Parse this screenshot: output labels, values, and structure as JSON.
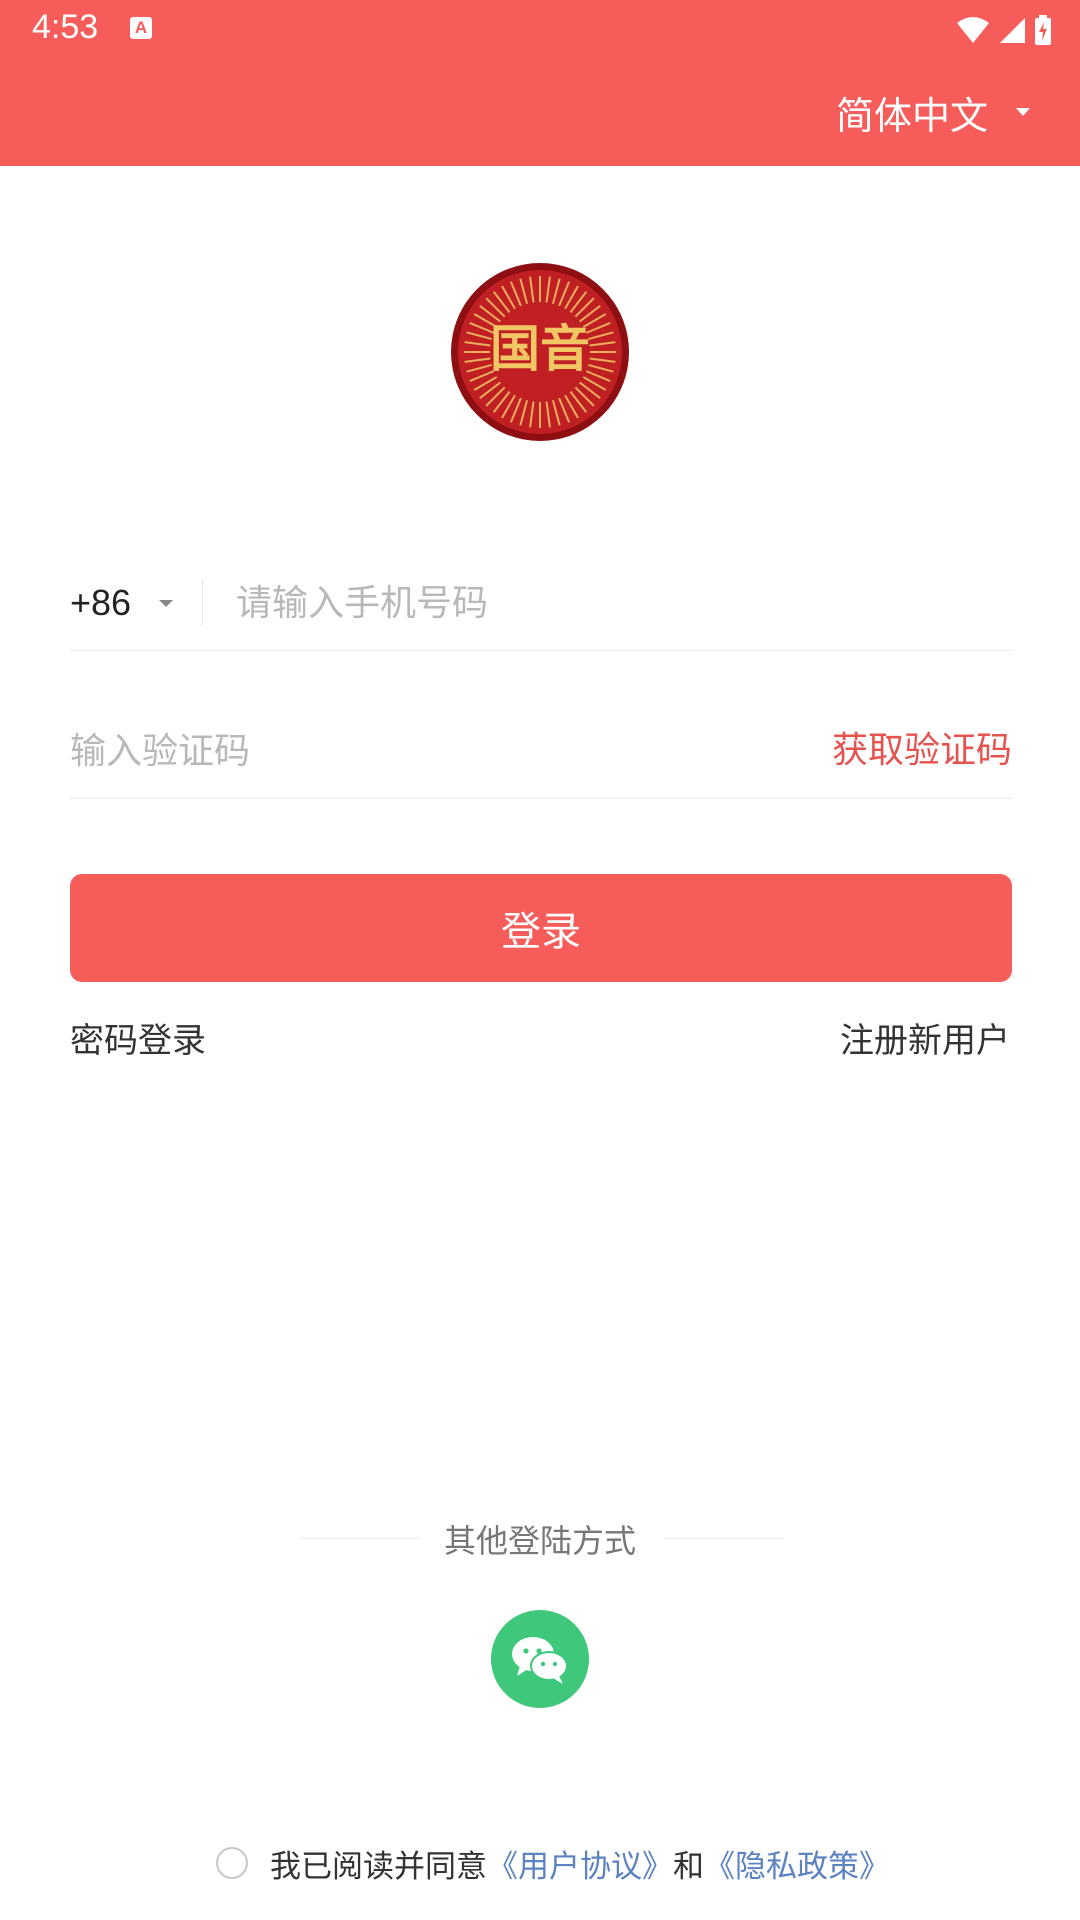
{
  "status_bar": {
    "time": "4:53",
    "notification_icon": "a-app-icon",
    "icons": [
      "wifi-icon",
      "signal-icon",
      "battery-charging-icon"
    ]
  },
  "header": {
    "language_label": "简体中文",
    "color": "#f65d5a"
  },
  "logo": {
    "text": "国音",
    "colors": {
      "ring": "#8e0f12",
      "face": "#c01f23",
      "gold": "#f1c766"
    }
  },
  "form": {
    "country_code": "+86",
    "phone_placeholder": "请输入手机号码",
    "code_placeholder": "输入验证码",
    "get_code_label": "获取验证码",
    "login_label": "登录",
    "password_login_label": "密码登录",
    "register_label": "注册新用户"
  },
  "other_login": {
    "title": "其他登陆方式",
    "methods": [
      "wechat-icon"
    ],
    "wechat_color": "#3fc77c"
  },
  "agreement": {
    "prefix": "我已阅读并同意",
    "user_agreement": "《用户协议》",
    "and": "和",
    "privacy_policy": "《隐私政策》",
    "checked": false,
    "link_color": "#5b82c1"
  }
}
